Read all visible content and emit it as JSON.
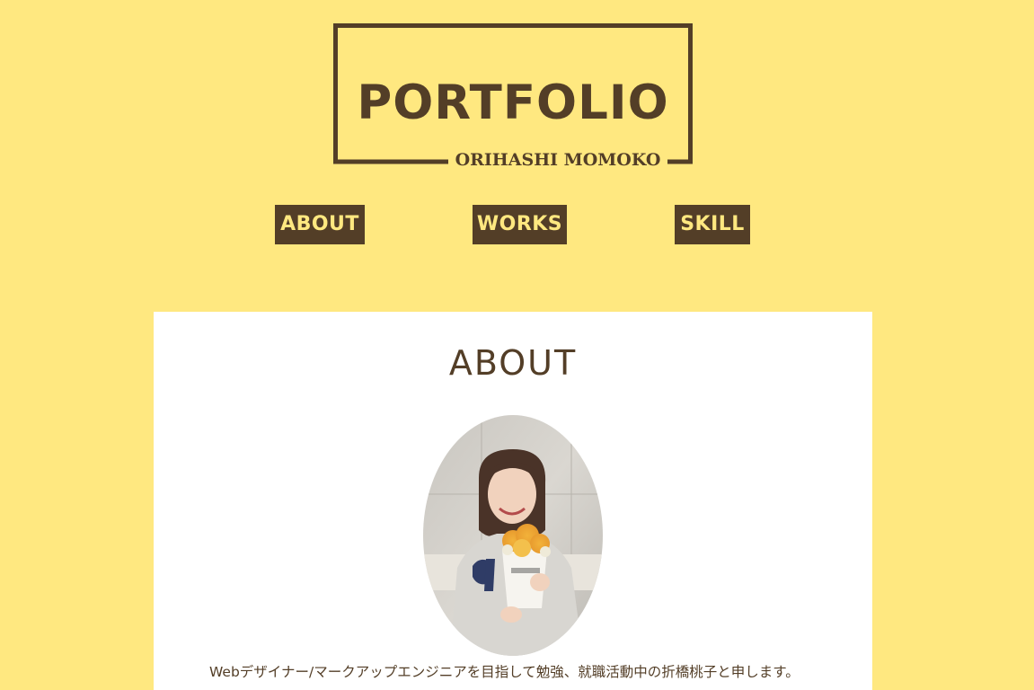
{
  "header": {
    "logo_title": "PORTFOLIO",
    "logo_subtitle": "ORIHASHI MOMOKO"
  },
  "nav": {
    "about_label": "ABOUT",
    "works_label": "WORKS",
    "skill_label": "SKILL"
  },
  "about": {
    "heading": "ABOUT",
    "photo_alt": "profile photo",
    "intro": "Webデザイナー/マークアップエンジニアを目指して勉強、就職活動中の折橋桃子と申します。"
  },
  "colors": {
    "background": "#FFE880",
    "brand_brown": "#533E27",
    "card": "#FFFFFF"
  }
}
